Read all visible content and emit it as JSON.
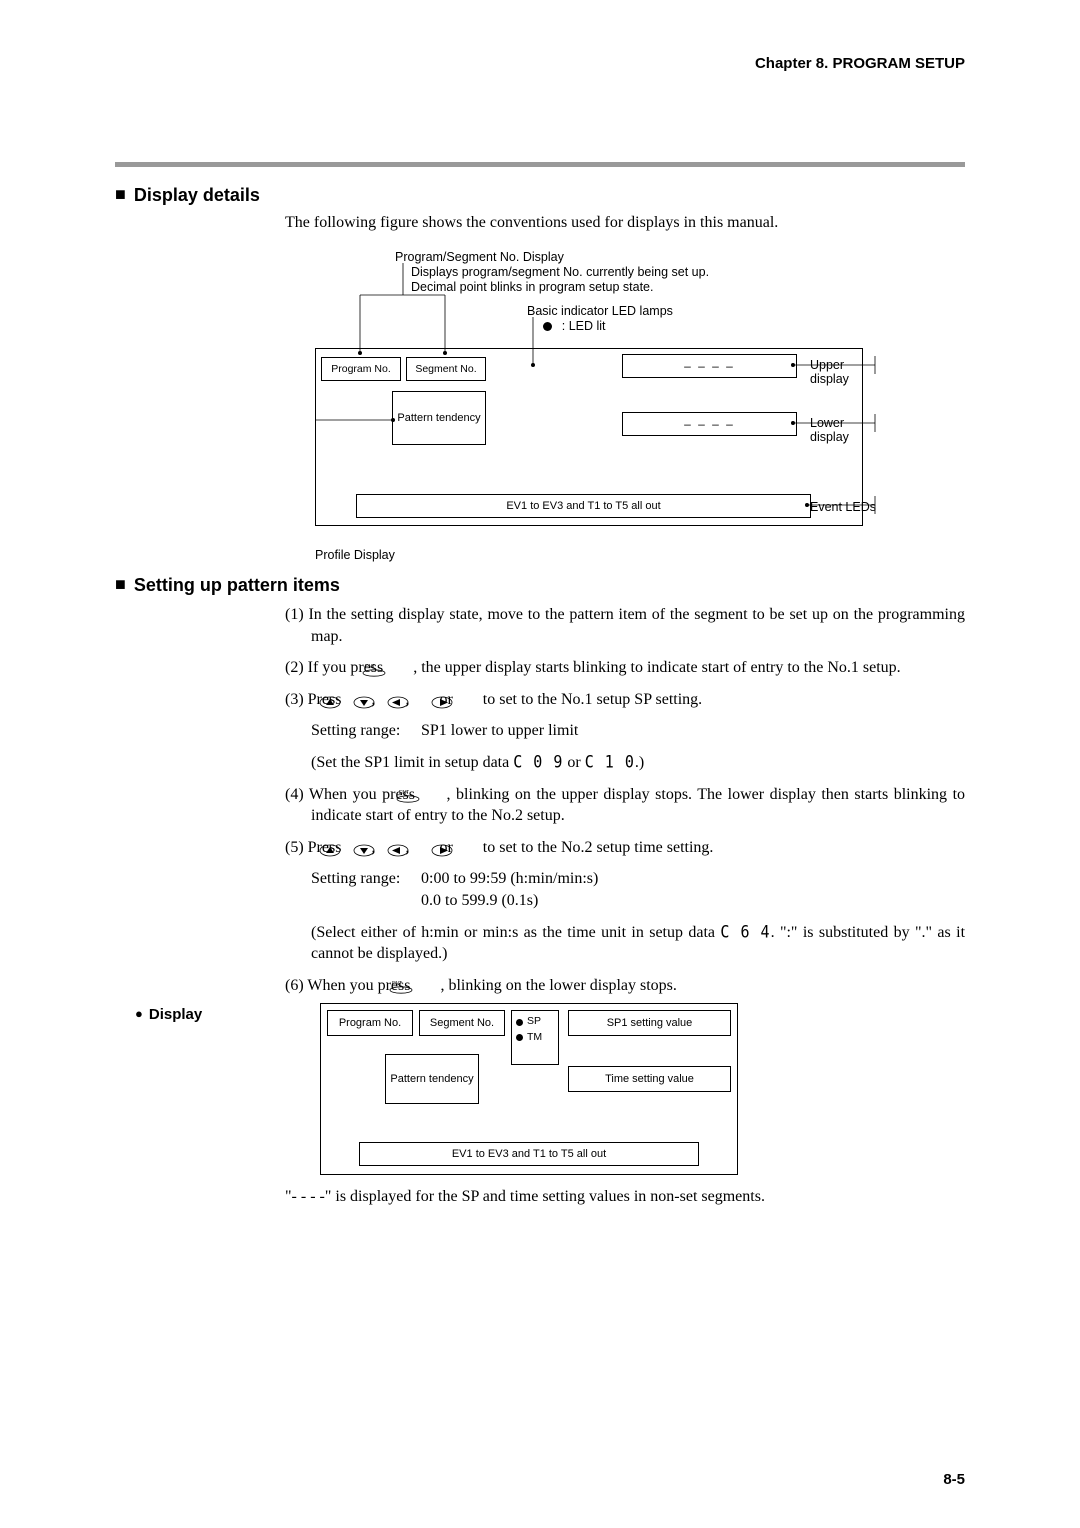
{
  "header": {
    "chapter": "Chapter 8. PROGRAM SETUP"
  },
  "sec1": {
    "title": "Display details",
    "intro": "The following figure shows the conventions used for displays in this manual."
  },
  "fig1": {
    "topTitle": "Program/Segment No. Display",
    "topLine1": "Displays program/segment No. currently being set up.",
    "topLine2": "Decimal point blinks in program setup state.",
    "basicLabel": "Basic indicator LED lamps",
    "ledLit": ": LED lit",
    "programNo": "Program No.",
    "segmentNo": "Segment No.",
    "dashes": "– – – –",
    "upperDisp": "Upper display",
    "pattern": "Pattern tendency",
    "lowerDisp": "Lower display",
    "eventRow": "EV1 to EV3 and T1 to T5 all out",
    "eventLeds": "Event LEDs",
    "profile": "Profile Display"
  },
  "sec2": {
    "title": "Setting up pattern items",
    "p1": "(1) In the setting display state, move to the pattern item of the segment to be set up on the programming map.",
    "p2a": "(2) If you press ",
    "p2b": ", the upper display starts blinking to indicate start of entry to the No.1 setup.",
    "p3a": "(3) Press ",
    "p3mid": " , ",
    "p3or": " or ",
    "p3b": " to set to the No.1 setup SP setting.",
    "p3range_l": "Setting range:",
    "p3range_r": "SP1 lower to upper limit",
    "p3set_a": "(Set the SP1 limit in setup data ",
    "p3set_c09": "C 0 9",
    "p3set_or": " or ",
    "p3set_c10": "C 1 0",
    "p3set_b": ".)",
    "p4a": "(4) When you press ",
    "p4b": ", blinking on the upper display stops. The lower display then starts blinking to indicate start of entry to the No.2 setup.",
    "p5a": "(5) Press ",
    "p5b": " to set to the No.2 setup time setting.",
    "p5range_l": "Setting range:",
    "p5range_r1": "0:00 to 99:59 (h:min/min:s)",
    "p5range_r2": "0.0 to 599.9 (0.1s)",
    "p5note_a": "(Select either of h:min or min:s as the time unit in setup data ",
    "p5note_c64": "C 6 4",
    "p5note_b": ". \":\" is substituted by \".\" as it cannot be displayed.)",
    "p6a": "(6) When you press ",
    "p6b": ", blinking on the lower display stops."
  },
  "displaySub": {
    "label": "Display"
  },
  "fig2": {
    "programNo": "Program No.",
    "segmentNo": "Segment No.",
    "sp": "SP",
    "tm": "TM",
    "sp1": "SP1 setting value",
    "time": "Time setting value",
    "pattern": "Pattern tendency",
    "eventRow": "EV1 to EV3 and T1 to T5 all out"
  },
  "caption2": "\"- - - -\" is displayed for the SP and time setting values in non-set segments.",
  "pagenum": "8-5"
}
